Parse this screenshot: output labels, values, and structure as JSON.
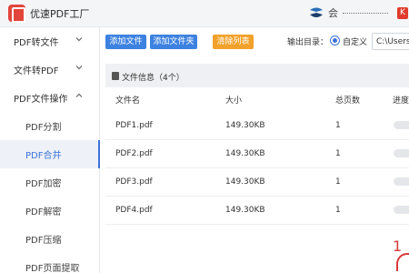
{
  "app": {
    "title": "优速PDF工厂",
    "user_text": "会",
    "badge_label": "K"
  },
  "sidebar": {
    "groups": [
      {
        "label": "PDF转文件"
      },
      {
        "label": "文件转PDF"
      },
      {
        "label": "PDF文件操作"
      }
    ],
    "items": [
      {
        "label": "PDF分割"
      },
      {
        "label": "PDF合并"
      },
      {
        "label": "PDF加密"
      },
      {
        "label": "PDF解密"
      },
      {
        "label": "PDF压缩"
      },
      {
        "label": "PDF页面提取"
      }
    ],
    "active_item": "PDF合并"
  },
  "toolbar": {
    "add_file": "添加文件",
    "add_folder": "添加文件夹",
    "clear_list": "清除列表",
    "output_label": "输出目录：",
    "output_option": "自定义",
    "output_path": "C:\\Users"
  },
  "panel": {
    "title": "文件信息（4个）",
    "columns": {
      "name": "文件名",
      "size": "大小",
      "pages": "总页数",
      "progress": "进度"
    },
    "rows": [
      {
        "name": "PDF1.pdf",
        "size": "149.30KB",
        "pages": "1"
      },
      {
        "name": "PDF2.pdf",
        "size": "149.30KB",
        "pages": "1"
      },
      {
        "name": "PDF3.pdf",
        "size": "149.30KB",
        "pages": "1"
      },
      {
        "name": "PDF4.pdf",
        "size": "149.30KB",
        "pages": "1"
      }
    ]
  },
  "annotation": {
    "marker": "1"
  },
  "colors": {
    "accent": "#3b73d9",
    "button_blue": "#3d82e0",
    "button_orange": "#f2a12a",
    "logo_red": "#e2453a"
  },
  "icons": [
    "pdf-logo-icon",
    "user-s-icon",
    "app-badge-icon",
    "chevron-down-icon",
    "chevron-up-icon",
    "document-icon"
  ]
}
